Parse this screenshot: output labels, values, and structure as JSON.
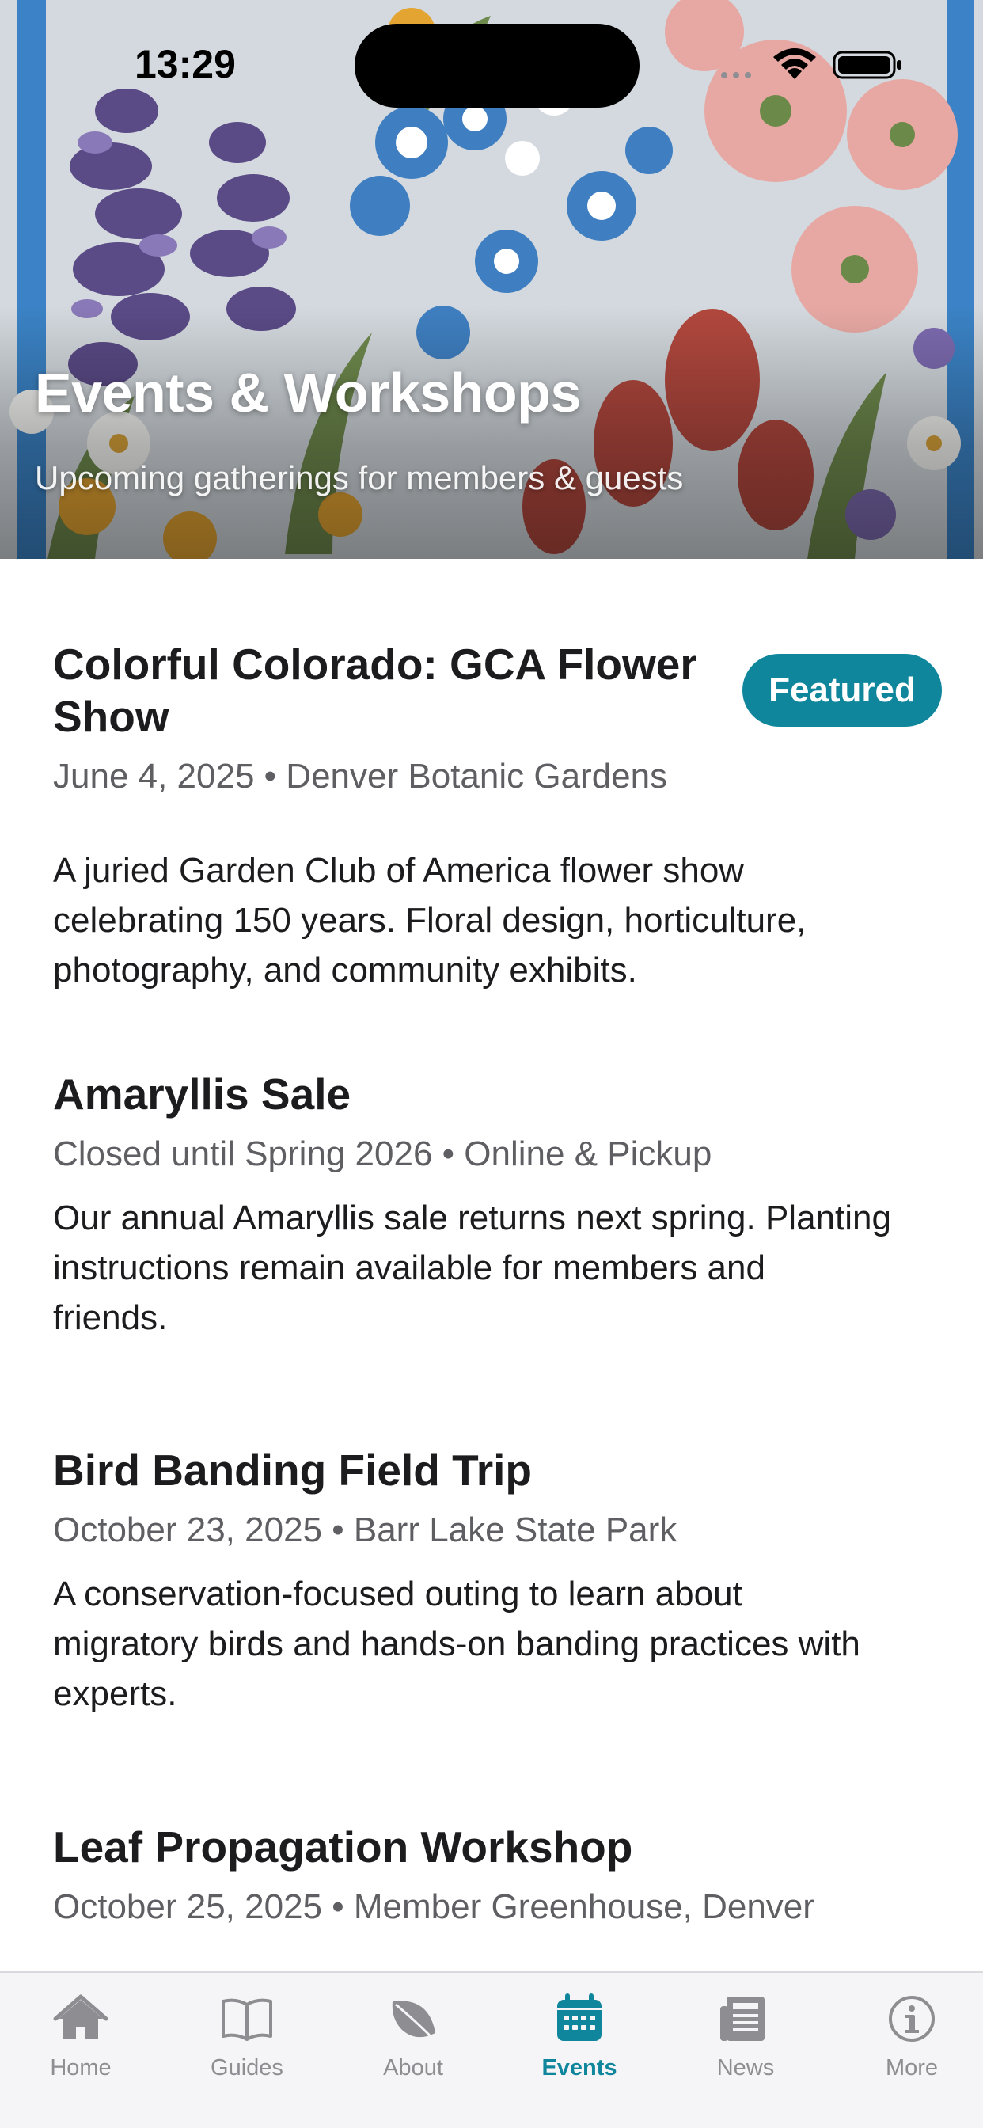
{
  "status_bar": {
    "time": "13:29"
  },
  "header": {
    "title": "Events & Workshops",
    "subtitle": "Upcoming gatherings for members & guests"
  },
  "events": [
    {
      "title_line1": "Colorful Colorado: GCA Flower",
      "title_line2": "Show",
      "badge": "Featured",
      "meta": "June 4, 2025 • Denver Botanic Gardens",
      "desc_lines": [
        "A juried Garden Club of America flower show",
        "celebrating 150 years. Floral design, horticulture,",
        "photography, and community exhibits."
      ]
    },
    {
      "title_line1": "Amaryllis Sale",
      "meta": "Closed until Spring 2026 • Online & Pickup",
      "desc_lines": [
        "Our annual Amaryllis sale returns next spring. Planting",
        "instructions remain available for members and",
        "friends."
      ]
    },
    {
      "title_line1": "Bird Banding Field Trip",
      "meta": "October 23, 2025 • Barr Lake State Park",
      "desc_lines": [
        "A conservation-focused outing to learn about",
        "migratory birds and hands-on banding practices with",
        "experts."
      ]
    },
    {
      "title_line1": "Leaf Propagation Workshop",
      "meta": "October 25, 2025 • Member Greenhouse, Denver"
    }
  ],
  "tabs": [
    {
      "label": "Home",
      "icon": "house-icon"
    },
    {
      "label": "Guides",
      "icon": "book-icon"
    },
    {
      "label": "About",
      "icon": "leaf-icon"
    },
    {
      "label": "Events",
      "icon": "calendar-icon",
      "active": true
    },
    {
      "label": "News",
      "icon": "newspaper-icon"
    },
    {
      "label": "More",
      "icon": "info-icon"
    }
  ],
  "colors": {
    "accent": "#10869c",
    "tab_inactive": "#8d8d92"
  }
}
